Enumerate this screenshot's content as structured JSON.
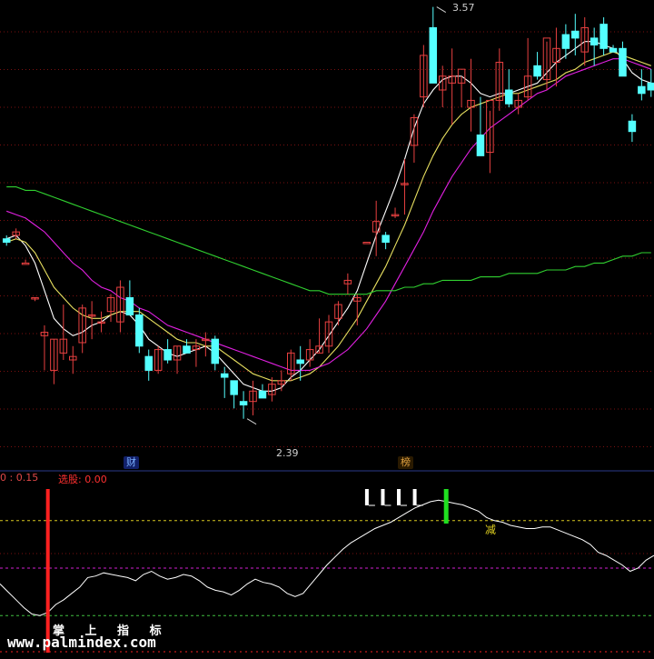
{
  "colors": {
    "up": "#e84040",
    "down": "#54ffff",
    "ma_white": "#ffffff",
    "ma_yellow": "#e8e060",
    "ma_magenta": "#e020e0",
    "ma_green": "#30d030",
    "grid": "#7a1010",
    "sep_blue": "#2a3a8a",
    "hline_yellow": "#d8c820",
    "hline_magenta": "#d020d0",
    "hline_green": "#40c040",
    "signal_red": "#ff2020",
    "signal_green": "#20e020"
  },
  "price_panel": {
    "high_label": "3.57",
    "low_label": "2.39",
    "badges": [
      {
        "text": "财",
        "color": "#60a0ff"
      },
      {
        "text": "榜",
        "color": "#e0a040"
      }
    ]
  },
  "indicator_panel": {
    "left_label": "0 : 0.15",
    "xg_label": "选股: 0.00",
    "signal_text": "减",
    "watermark_top": "掌 上 指 标",
    "watermark_bottom": "www.palmindex.com"
  },
  "chart_data": [
    {
      "type": "candlestick",
      "title": "",
      "ylim": [
        2.3,
        3.6
      ],
      "candles": [
        [
          2.91,
          2.92,
          2.89,
          2.9
        ],
        [
          2.92,
          2.94,
          2.91,
          2.93
        ],
        [
          2.84,
          2.85,
          2.84,
          2.84
        ],
        [
          2.74,
          2.74,
          2.73,
          2.74
        ],
        [
          2.63,
          2.66,
          2.53,
          2.64
        ],
        [
          2.53,
          2.62,
          2.49,
          2.62
        ],
        [
          2.58,
          2.72,
          2.56,
          2.62
        ],
        [
          2.56,
          2.6,
          2.52,
          2.57
        ],
        [
          2.61,
          2.72,
          2.58,
          2.71
        ],
        [
          2.69,
          2.73,
          2.62,
          2.69
        ],
        [
          2.67,
          2.7,
          2.64,
          2.67
        ],
        [
          2.7,
          2.75,
          2.67,
          2.74
        ],
        [
          2.67,
          2.79,
          2.64,
          2.77
        ],
        [
          2.74,
          2.79,
          2.7,
          2.69
        ],
        [
          2.69,
          2.71,
          2.58,
          2.6
        ],
        [
          2.57,
          2.59,
          2.5,
          2.53
        ],
        [
          2.53,
          2.6,
          2.52,
          2.59
        ],
        [
          2.59,
          2.62,
          2.55,
          2.56
        ],
        [
          2.56,
          2.6,
          2.52,
          2.6
        ],
        [
          2.6,
          2.62,
          2.58,
          2.58
        ],
        [
          2.59,
          2.62,
          2.54,
          2.6
        ],
        [
          2.62,
          2.64,
          2.57,
          2.62
        ],
        [
          2.62,
          2.63,
          2.53,
          2.55
        ],
        [
          2.52,
          2.54,
          2.45,
          2.51
        ],
        [
          2.5,
          2.48,
          2.42,
          2.46
        ],
        [
          2.44,
          2.47,
          2.39,
          2.43
        ],
        [
          2.44,
          2.5,
          2.4,
          2.47
        ],
        [
          2.47,
          2.49,
          2.45,
          2.45
        ],
        [
          2.46,
          2.51,
          2.44,
          2.49
        ],
        [
          2.49,
          2.53,
          2.47,
          2.5
        ],
        [
          2.52,
          2.59,
          2.5,
          2.58
        ],
        [
          2.56,
          2.6,
          2.5,
          2.55
        ],
        [
          2.56,
          2.62,
          2.54,
          2.59
        ],
        [
          2.58,
          2.68,
          2.58,
          2.6
        ],
        [
          2.6,
          2.69,
          2.58,
          2.67
        ],
        [
          2.68,
          2.73,
          2.66,
          2.72
        ],
        [
          2.78,
          2.81,
          2.75,
          2.79
        ],
        [
          2.73,
          2.75,
          2.66,
          2.74
        ],
        [
          2.9,
          2.9,
          2.9,
          2.9
        ],
        [
          2.93,
          3.02,
          2.86,
          2.96
        ],
        [
          2.92,
          2.93,
          2.88,
          2.9
        ],
        [
          2.98,
          3.0,
          2.97,
          2.98
        ],
        [
          3.07,
          3.14,
          2.98,
          3.07
        ],
        [
          3.18,
          3.27,
          3.13,
          3.26
        ],
        [
          3.32,
          3.47,
          3.29,
          3.44
        ],
        [
          3.52,
          3.58,
          3.43,
          3.36
        ],
        [
          3.34,
          3.41,
          3.29,
          3.38
        ],
        [
          3.36,
          3.46,
          3.24,
          3.38
        ],
        [
          3.36,
          3.38,
          3.29,
          3.4
        ],
        [
          3.29,
          3.43,
          3.22,
          3.31
        ],
        [
          3.21,
          3.32,
          3.17,
          3.15
        ],
        [
          3.16,
          3.28,
          3.1,
          3.31
        ],
        [
          3.31,
          3.46,
          3.28,
          3.42
        ],
        [
          3.34,
          3.4,
          3.29,
          3.3
        ],
        [
          3.29,
          3.33,
          3.27,
          3.31
        ],
        [
          3.32,
          3.49,
          3.31,
          3.38
        ],
        [
          3.41,
          3.45,
          3.37,
          3.38
        ],
        [
          3.37,
          3.48,
          3.34,
          3.49
        ],
        [
          3.42,
          3.52,
          3.35,
          3.46
        ],
        [
          3.5,
          3.53,
          3.43,
          3.46
        ],
        [
          3.51,
          3.56,
          3.44,
          3.49
        ],
        [
          3.45,
          3.55,
          3.41,
          3.52
        ],
        [
          3.49,
          3.52,
          3.41,
          3.47
        ],
        [
          3.53,
          3.55,
          3.44,
          3.46
        ],
        [
          3.46,
          3.47,
          3.45,
          3.45
        ],
        [
          3.46,
          3.48,
          3.38,
          3.38
        ],
        [
          3.25,
          3.27,
          3.19,
          3.22
        ],
        [
          3.35,
          3.4,
          3.31,
          3.33
        ],
        [
          3.36,
          3.4,
          3.32,
          3.34
        ]
      ],
      "series": [
        {
          "name": "",
          "color_key": "ma_white",
          "values": [
            2.91,
            2.92,
            2.89,
            2.84,
            2.76,
            2.68,
            2.65,
            2.63,
            2.64,
            2.66,
            2.67,
            2.69,
            2.7,
            2.69,
            2.66,
            2.62,
            2.6,
            2.58,
            2.57,
            2.58,
            2.59,
            2.6,
            2.58,
            2.55,
            2.52,
            2.49,
            2.48,
            2.47,
            2.47,
            2.48,
            2.51,
            2.53,
            2.56,
            2.59,
            2.63,
            2.67,
            2.71,
            2.76,
            2.84,
            2.92,
            2.99,
            3.06,
            3.14,
            3.23,
            3.3,
            3.34,
            3.37,
            3.38,
            3.38,
            3.36,
            3.33,
            3.32,
            3.33,
            3.33,
            3.34,
            3.35,
            3.36,
            3.39,
            3.42,
            3.44,
            3.46,
            3.48,
            3.48,
            3.47,
            3.46,
            3.43,
            3.39,
            3.37,
            3.36
          ]
        },
        {
          "name": "",
          "color_key": "ma_yellow",
          "values": [
            2.9,
            2.91,
            2.9,
            2.87,
            2.82,
            2.77,
            2.74,
            2.71,
            2.69,
            2.68,
            2.68,
            2.69,
            2.7,
            2.7,
            2.7,
            2.68,
            2.66,
            2.64,
            2.62,
            2.61,
            2.61,
            2.6,
            2.6,
            2.58,
            2.56,
            2.54,
            2.52,
            2.51,
            2.5,
            2.5,
            2.5,
            2.51,
            2.52,
            2.54,
            2.57,
            2.6,
            2.64,
            2.68,
            2.73,
            2.78,
            2.83,
            2.89,
            2.95,
            3.02,
            3.09,
            3.15,
            3.2,
            3.24,
            3.27,
            3.29,
            3.3,
            3.31,
            3.32,
            3.33,
            3.33,
            3.34,
            3.35,
            3.36,
            3.37,
            3.39,
            3.4,
            3.42,
            3.43,
            3.44,
            3.45,
            3.44,
            3.43,
            3.42,
            3.41
          ]
        },
        {
          "name": "",
          "color_key": "ma_magenta",
          "values": [
            2.99,
            2.98,
            2.97,
            2.95,
            2.93,
            2.9,
            2.87,
            2.84,
            2.82,
            2.79,
            2.77,
            2.76,
            2.74,
            2.73,
            2.71,
            2.7,
            2.68,
            2.66,
            2.65,
            2.64,
            2.63,
            2.62,
            2.61,
            2.6,
            2.59,
            2.58,
            2.57,
            2.56,
            2.55,
            2.54,
            2.53,
            2.53,
            2.53,
            2.54,
            2.55,
            2.57,
            2.59,
            2.62,
            2.65,
            2.69,
            2.73,
            2.78,
            2.83,
            2.88,
            2.93,
            2.99,
            3.04,
            3.09,
            3.13,
            3.17,
            3.2,
            3.23,
            3.25,
            3.27,
            3.29,
            3.31,
            3.33,
            3.34,
            3.36,
            3.38,
            3.39,
            3.4,
            3.41,
            3.42,
            3.43,
            3.43,
            3.42,
            3.41,
            3.4
          ]
        },
        {
          "name": "",
          "color_key": "ma_green",
          "values": [
            3.06,
            3.06,
            3.05,
            3.05,
            3.04,
            3.03,
            3.02,
            3.01,
            3.0,
            2.99,
            2.98,
            2.97,
            2.96,
            2.95,
            2.94,
            2.93,
            2.92,
            2.91,
            2.9,
            2.89,
            2.88,
            2.87,
            2.86,
            2.85,
            2.84,
            2.83,
            2.82,
            2.81,
            2.8,
            2.79,
            2.78,
            2.77,
            2.76,
            2.76,
            2.75,
            2.75,
            2.75,
            2.75,
            2.75,
            2.76,
            2.76,
            2.76,
            2.77,
            2.77,
            2.78,
            2.78,
            2.79,
            2.79,
            2.79,
            2.79,
            2.8,
            2.8,
            2.8,
            2.81,
            2.81,
            2.81,
            2.81,
            2.82,
            2.82,
            2.82,
            2.83,
            2.83,
            2.84,
            2.84,
            2.85,
            2.86,
            2.86,
            2.87,
            2.87
          ]
        }
      ]
    },
    {
      "type": "line",
      "title": "",
      "ylim": [
        0,
        100
      ],
      "hlines": [
        {
          "value": 80,
          "color_key": "hline_yellow"
        },
        {
          "value": 50,
          "color_key": "hline_magenta"
        },
        {
          "value": 20,
          "color_key": "hline_green"
        }
      ],
      "series": [
        {
          "name": "",
          "color_key": "ma_white",
          "values": [
            40,
            35,
            30,
            25,
            21,
            20,
            22,
            27,
            30,
            34,
            38,
            44,
            45,
            47,
            46,
            45,
            44,
            42,
            46,
            48,
            45,
            43,
            44,
            46,
            45,
            42,
            38,
            36,
            35,
            33,
            36,
            40,
            43,
            41,
            40,
            38,
            34,
            32,
            34,
            40,
            46,
            52,
            57,
            62,
            66,
            69,
            72,
            75,
            77,
            79,
            82,
            85,
            88,
            90,
            92,
            93,
            92,
            91,
            90,
            88,
            86,
            82,
            80,
            79,
            77,
            76,
            75,
            75,
            76,
            76,
            74,
            72,
            70,
            68,
            65,
            60,
            58,
            55,
            52,
            48,
            50,
            55,
            58
          ]
        }
      ],
      "markers": [
        {
          "kind": "bar_up_white",
          "index": 46
        },
        {
          "kind": "bar_up_white",
          "index": 48
        },
        {
          "kind": "bar_up_white",
          "index": 50
        },
        {
          "kind": "bar_up_white",
          "index": 52
        },
        {
          "kind": "signal_green",
          "index": 56
        },
        {
          "kind": "signal_red",
          "index": 6
        }
      ]
    }
  ]
}
